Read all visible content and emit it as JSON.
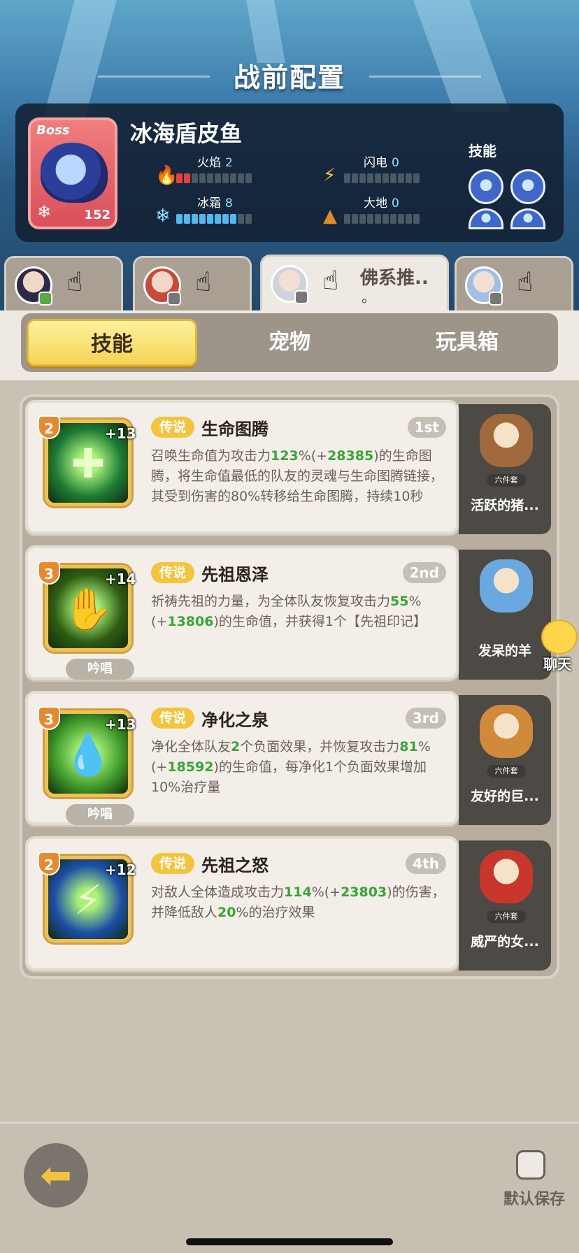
{
  "page_title": "战前配置",
  "boss": {
    "badge": "Boss",
    "name": "冰海盾皮鱼",
    "level": "152",
    "skills_label": "技能",
    "stats": [
      {
        "label": "火焰",
        "value": "2",
        "filled": 2,
        "color": "red"
      },
      {
        "label": "闪电",
        "value": "0",
        "filled": 0,
        "color": "red"
      },
      {
        "label": "冰霜",
        "value": "8",
        "filled": 8,
        "color": "blue"
      },
      {
        "label": "大地",
        "value": "0",
        "filled": 0,
        "color": "red"
      }
    ]
  },
  "hero_tabs": [
    {
      "icon": "hero-avatar",
      "active": false,
      "name": ""
    },
    {
      "icon": "hero-avatar",
      "active": false,
      "name": ""
    },
    {
      "icon": "hero-avatar",
      "active": true,
      "name": "佛系推..",
      "name_line2": "。"
    },
    {
      "icon": "hero-avatar",
      "active": false,
      "name": ""
    }
  ],
  "category_tabs": {
    "skills": "技能",
    "pets": "宠物",
    "toybox": "玩具箱",
    "active": "skills"
  },
  "skills": [
    {
      "level": "2",
      "plus": "+13",
      "rarity": "传说",
      "name": "生命图腾",
      "rank": "1st",
      "chant": "",
      "desc_parts": [
        "召唤生命值为攻击力",
        "123",
        "%(+",
        "28385",
        ")的生命图腾，将生命值最低的队友的灵魂与生命图腾链接，其受到伤害的80%转移给生命图腾，持续10秒"
      ],
      "icon_color": "#1d7a34",
      "icon_glyph": "✚",
      "pet": {
        "set": "六件套",
        "name": "活跃的猪...",
        "color": "#a06a3c"
      }
    },
    {
      "level": "3",
      "plus": "+14",
      "rarity": "传说",
      "name": "先祖恩泽",
      "rank": "2nd",
      "chant": "吟唱",
      "desc_parts": [
        "祈祷先祖的力量，为全体队友恢复攻击力",
        "55",
        "%(+",
        "13806",
        ")的生命值，并获得1个【先祖印记】"
      ],
      "icon_color": "#2f5d12",
      "icon_glyph": "✋",
      "pet": {
        "set": "",
        "name": "发呆的羊",
        "color": "#6aa9e0"
      }
    },
    {
      "level": "3",
      "plus": "+13",
      "rarity": "传说",
      "name": "净化之泉",
      "rank": "3rd",
      "chant": "吟唱",
      "desc_parts": [
        "净化全体队友",
        "2",
        "个负面效果，并恢复攻击力",
        "81",
        "%(+",
        "18592",
        ")的生命值，每净化1个负面效果增加10%治疗量"
      ],
      "icon_color": "#3f9a2a",
      "icon_glyph": "💧",
      "pet": {
        "set": "六件套",
        "name": "友好的巨...",
        "color": "#d08a3a"
      }
    },
    {
      "level": "2",
      "plus": "+12",
      "rarity": "传说",
      "name": "先祖之怒",
      "rank": "4th",
      "chant": "",
      "desc_parts": [
        "对敌人全体造成攻击力",
        "114",
        "%(+",
        "23803",
        ")的伤害，并降低敌人",
        "20",
        "%的治疗效果"
      ],
      "icon_color": "#1c4fa6",
      "icon_glyph": "⚡",
      "pet": {
        "set": "六件套",
        "name": "威严的女...",
        "color": "#c8362c"
      }
    }
  ],
  "chat_label": "聊天",
  "save_label": "默认保存"
}
